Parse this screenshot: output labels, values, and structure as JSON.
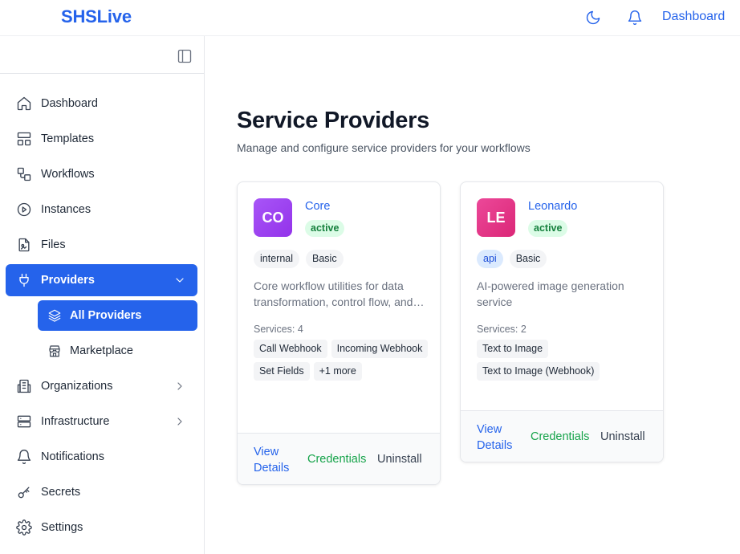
{
  "app": {
    "brand": "SHSLive"
  },
  "header": {
    "dashboard_link": "Dashboard",
    "icons": [
      "moon-icon",
      "bell-icon"
    ]
  },
  "sidebar": {
    "items": [
      {
        "label": "Dashboard",
        "icon": "home-icon"
      },
      {
        "label": "Templates",
        "icon": "layout-icon"
      },
      {
        "label": "Workflows",
        "icon": "workflow-icon"
      },
      {
        "label": "Instances",
        "icon": "play-circle-icon"
      },
      {
        "label": "Files",
        "icon": "file-icon"
      },
      {
        "label": "Providers",
        "icon": "plug-icon",
        "active": true,
        "expanded": true
      },
      {
        "label": "Organizations",
        "icon": "building-icon"
      },
      {
        "label": "Infrastructure",
        "icon": "server-icon"
      },
      {
        "label": "Notifications",
        "icon": "bell-icon"
      },
      {
        "label": "Secrets",
        "icon": "key-icon"
      },
      {
        "label": "Settings",
        "icon": "gear-icon"
      }
    ],
    "providers_sub": [
      {
        "label": "All Providers",
        "icon": "layers-icon",
        "active": true
      },
      {
        "label": "Marketplace",
        "icon": "store-icon"
      }
    ]
  },
  "main": {
    "title": "Service Providers",
    "subtitle": "Manage and configure service providers for your workflows",
    "providers": [
      {
        "initials": "CO",
        "name": "Core",
        "status": "active",
        "tags": [
          "internal",
          "Basic"
        ],
        "description": "Core workflow utilities for data transformation, control flow, and more",
        "services_label": "Services: 4",
        "services": [
          "Call Webhook",
          "Incoming Webhook",
          "Set Fields",
          "+1 more"
        ],
        "actions": {
          "view": "View Details",
          "credentials": "Credentials",
          "uninstall": "Uninstall"
        }
      },
      {
        "initials": "LE",
        "name": "Leonardo",
        "status": "active",
        "tags": [
          "api",
          "Basic"
        ],
        "description": "AI-powered image generation service",
        "services_label": "Services: 2",
        "services": [
          "Text to Image",
          "Text to Image (Webhook)"
        ],
        "actions": {
          "view": "View Details",
          "credentials": "Credentials",
          "uninstall": "Uninstall"
        }
      }
    ]
  },
  "colors": {
    "accent": "#2563eb",
    "status_green": "#15803d",
    "core_avatar": "#a855f7",
    "leonardo_avatar": "#ec4899"
  }
}
